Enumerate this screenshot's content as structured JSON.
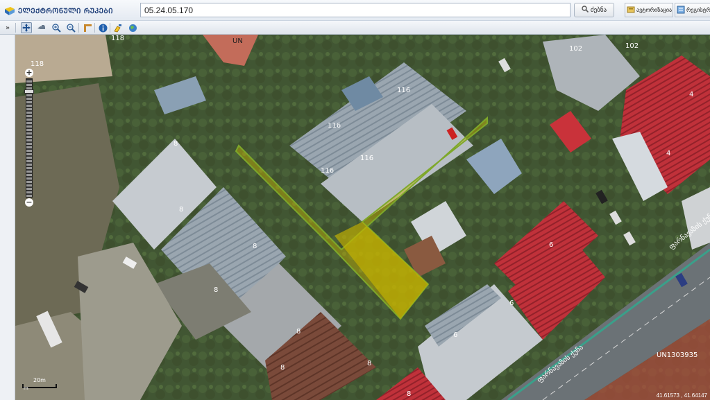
{
  "header": {
    "title": "ᲔᲚᲔᲥᲢᲠᲝᲜᲣᲚᲘ ᲠᲣᲙᲔᲑᲘ",
    "search_value": "05.24.05.170",
    "search_button": "ძებნა",
    "layers_button": "ავტორიზაცია",
    "legend_button": "რეგისტრ"
  },
  "toolbar": {
    "collapse": "»",
    "tools": [
      "pan-icon",
      "hand-icon",
      "zoom-in-icon",
      "zoom-out-icon",
      "measure-icon",
      "info-icon",
      "highlighter-icon",
      "globe-icon"
    ]
  },
  "map": {
    "parcel_labels": [
      {
        "text": "118"
      },
      {
        "text": "118"
      },
      {
        "text": "UN"
      },
      {
        "text": "102"
      },
      {
        "text": "102"
      },
      {
        "text": "116"
      },
      {
        "text": "116"
      },
      {
        "text": "116"
      },
      {
        "text": "116"
      },
      {
        "text": "4"
      },
      {
        "text": "4"
      },
      {
        "text": "8"
      },
      {
        "text": "8"
      },
      {
        "text": "8"
      },
      {
        "text": "8"
      },
      {
        "text": "8"
      },
      {
        "text": "8"
      },
      {
        "text": "8"
      },
      {
        "text": "6"
      },
      {
        "text": "6"
      },
      {
        "text": "6"
      },
      {
        "text": "8"
      },
      {
        "text": "UN1303935"
      }
    ],
    "street_label_1": "ფარნავაზის ქუჩა",
    "street_label_2": "ფარნავაზის ქუჩა",
    "scale_label": "20m",
    "scale_unit": "m",
    "coordinates": "41.61573 , 41.64147",
    "highlight_color": "#c8b400"
  }
}
